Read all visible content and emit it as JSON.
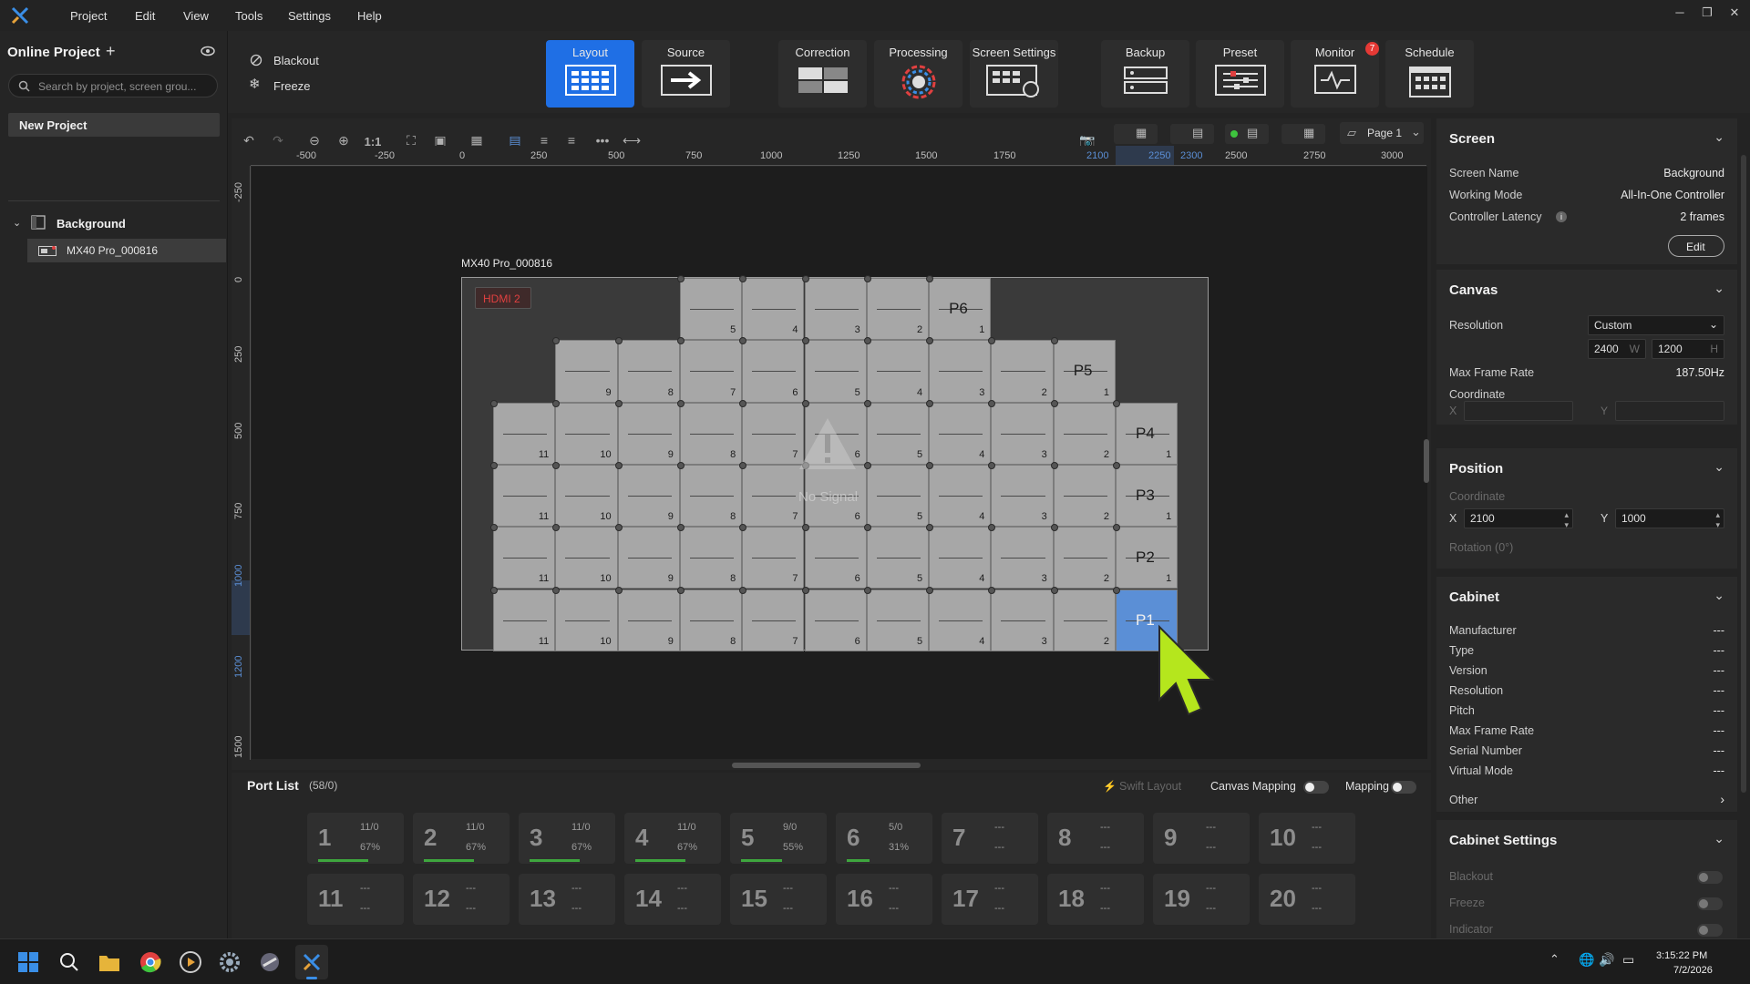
{
  "menu": {
    "items": [
      "Project",
      "Edit",
      "View",
      "Tools",
      "Settings",
      "Help"
    ]
  },
  "left": {
    "title": "Online Project",
    "search_placeholder": "Search by project, screen grou...",
    "new_project": "New Project",
    "tree": {
      "root": "Background",
      "child": "MX40 Pro_000816"
    }
  },
  "toolbar": {
    "blackout": "Blackout",
    "freeze": "Freeze",
    "tabs": [
      "Layout",
      "Source",
      "Correction",
      "Processing",
      "Screen Settings",
      "Backup",
      "Preset",
      "Monitor",
      "Schedule"
    ],
    "monitor_badge": "7",
    "zoom_label": "1:1",
    "page_label": "Page 1"
  },
  "ruler": {
    "top": [
      "-500",
      "-250",
      "0",
      "250",
      "500",
      "750",
      "1000",
      "1250",
      "1500",
      "1750",
      "2100",
      "2250",
      "2300",
      "2500",
      "2750",
      "3000"
    ],
    "left": [
      "-250",
      "0",
      "250",
      "500",
      "750",
      "1000",
      "1200",
      "1500"
    ]
  },
  "canvas": {
    "screen_label": "MX40 Pro_000816",
    "input_badge": "HDMI 2",
    "no_signal": "No Signal",
    "ports": [
      "P6",
      "P5",
      "P4",
      "P3",
      "P2",
      "P1"
    ]
  },
  "right": {
    "screen": {
      "title": "Screen",
      "name_l": "Screen Name",
      "name_v": "Background",
      "mode_l": "Working Mode",
      "mode_v": "All-In-One Controller",
      "lat_l": "Controller Latency",
      "lat_v": "2 frames",
      "edit": "Edit"
    },
    "canvas": {
      "title": "Canvas",
      "res_l": "Resolution",
      "res_v": "Custom",
      "w": "2400",
      "w_l": "W",
      "h": "1200",
      "h_l": "H",
      "fr_l": "Max Frame Rate",
      "fr_v": "187.50Hz",
      "coord_l": "Coordinate",
      "x_l": "X",
      "y_l": "Y"
    },
    "position": {
      "title": "Position",
      "coord_l": "Coordinate",
      "x_l": "X",
      "x": "2100",
      "y_l": "Y",
      "y": "1000",
      "rot_l": "Rotation (0°)"
    },
    "cabinet": {
      "title": "Cabinet",
      "rows": [
        {
          "l": "Manufacturer",
          "v": "---"
        },
        {
          "l": "Type",
          "v": "---"
        },
        {
          "l": "Version",
          "v": "---"
        },
        {
          "l": "Resolution",
          "v": "---"
        },
        {
          "l": "Pitch",
          "v": "---"
        },
        {
          "l": "Max Frame Rate",
          "v": "---"
        },
        {
          "l": "Serial Number",
          "v": "---"
        },
        {
          "l": "Virtual Mode",
          "v": "---"
        }
      ],
      "other": "Other"
    },
    "cab_settings": {
      "title": "Cabinet Settings",
      "blackout": "Blackout",
      "freeze": "Freeze",
      "indicator": "Indicator"
    }
  },
  "portlist": {
    "title": "Port List",
    "count": "(58/0)",
    "swift": "Swift Layout",
    "canvas_mapping": "Canvas Mapping",
    "mapping": "Mapping",
    "ports": [
      {
        "n": "1",
        "a": "11/0",
        "b": "67%",
        "fill": 0.67
      },
      {
        "n": "2",
        "a": "11/0",
        "b": "67%",
        "fill": 0.67
      },
      {
        "n": "3",
        "a": "11/0",
        "b": "67%",
        "fill": 0.67
      },
      {
        "n": "4",
        "a": "11/0",
        "b": "67%",
        "fill": 0.67
      },
      {
        "n": "5",
        "a": "9/0",
        "b": "55%",
        "fill": 0.55
      },
      {
        "n": "6",
        "a": "5/0",
        "b": "31%",
        "fill": 0.31
      },
      {
        "n": "7",
        "a": "---",
        "b": "---",
        "fill": 0
      },
      {
        "n": "8",
        "a": "---",
        "b": "---",
        "fill": 0
      },
      {
        "n": "9",
        "a": "---",
        "b": "---",
        "fill": 0
      },
      {
        "n": "10",
        "a": "---",
        "b": "---",
        "fill": 0
      },
      {
        "n": "11",
        "a": "---",
        "b": "---",
        "fill": 0
      },
      {
        "n": "12",
        "a": "---",
        "b": "---",
        "fill": 0
      },
      {
        "n": "13",
        "a": "---",
        "b": "---",
        "fill": 0
      },
      {
        "n": "14",
        "a": "---",
        "b": "---",
        "fill": 0
      },
      {
        "n": "15",
        "a": "---",
        "b": "---",
        "fill": 0
      },
      {
        "n": "16",
        "a": "---",
        "b": "---",
        "fill": 0
      },
      {
        "n": "17",
        "a": "---",
        "b": "---",
        "fill": 0
      },
      {
        "n": "18",
        "a": "---",
        "b": "---",
        "fill": 0
      },
      {
        "n": "19",
        "a": "---",
        "b": "---",
        "fill": 0
      },
      {
        "n": "20",
        "a": "---",
        "b": "---",
        "fill": 0
      }
    ]
  },
  "taskbar": {
    "time": "3:15:22 PM",
    "date": "7/2/2026"
  },
  "colors": {
    "accent": "#1f6fe5",
    "badge": "#e53935",
    "cursor": "#b5e61d",
    "hdmi": "#e04040"
  }
}
